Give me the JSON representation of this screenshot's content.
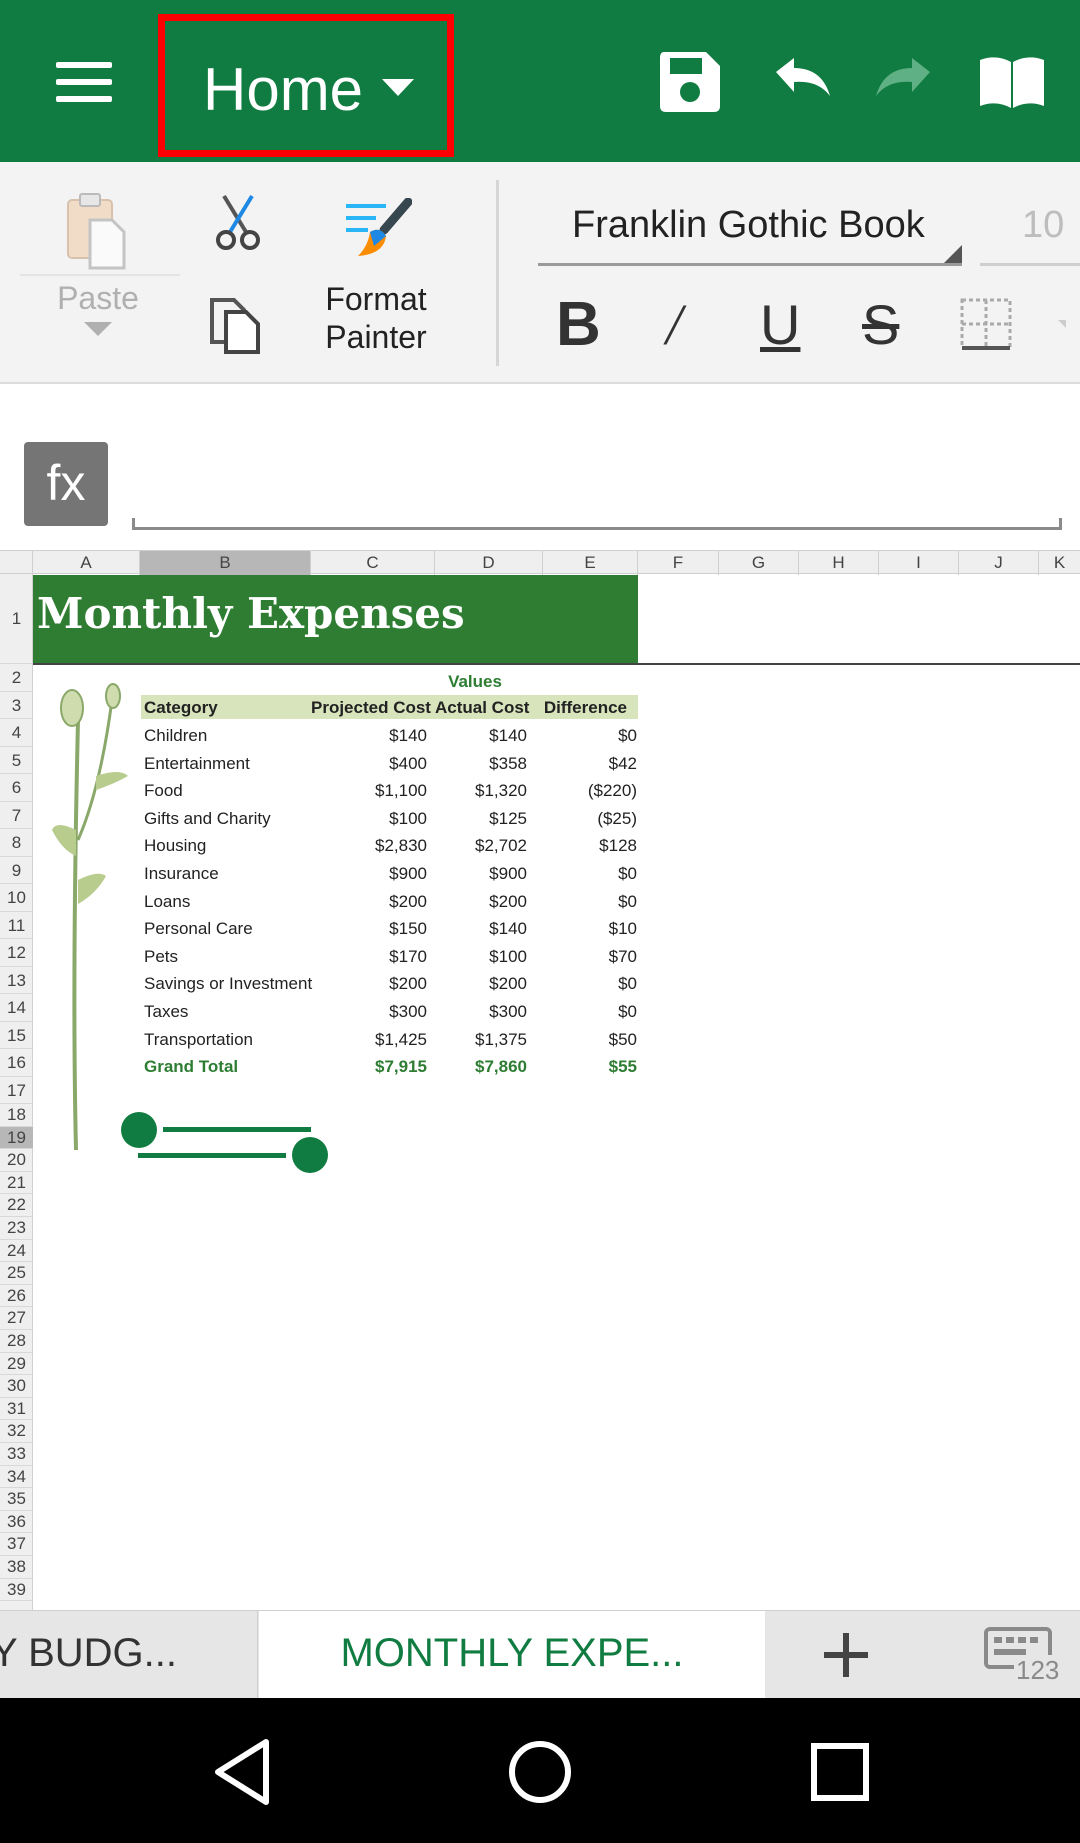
{
  "topbar": {
    "tab_label": "Home",
    "icons": [
      "menu-icon",
      "save-icon",
      "undo-icon",
      "redo-icon",
      "read-mode-icon"
    ],
    "accent_color": "#107c41",
    "highlight_color": "#ff0000"
  },
  "ribbon": {
    "paste_label": "Paste",
    "format_painter_label": "Format Painter",
    "font_name": "Franklin Gothic Book",
    "font_size": "10",
    "bold_label": "B",
    "italic_label": "/",
    "underline_label": "U",
    "strike_label": "S"
  },
  "formula_bar": {
    "fx_label": "fx",
    "value": ""
  },
  "grid": {
    "columns": [
      "A",
      "B",
      "C",
      "D",
      "E",
      "F",
      "G",
      "H",
      "I",
      "J",
      "K"
    ],
    "selected_column": "B",
    "rows": [
      "1",
      "2",
      "3",
      "4",
      "5",
      "6",
      "7",
      "8",
      "9",
      "10",
      "11",
      "12",
      "13",
      "14",
      "15",
      "16",
      "17",
      "18",
      "19",
      "20",
      "21",
      "22",
      "23",
      "24",
      "25",
      "26",
      "27",
      "28",
      "29",
      "30",
      "31",
      "32",
      "33",
      "34",
      "35",
      "36",
      "37",
      "38",
      "39"
    ],
    "selected_row": "19"
  },
  "sheet": {
    "title": "Monthly Expenses",
    "values_label": "Values",
    "headers": [
      "Category",
      "Projected Cost",
      "Actual Cost",
      "Difference"
    ],
    "rows": [
      [
        "Children",
        "$140",
        "$140",
        "$0"
      ],
      [
        "Entertainment",
        "$400",
        "$358",
        "$42"
      ],
      [
        "Food",
        "$1,100",
        "$1,320",
        "($220)"
      ],
      [
        "Gifts and Charity",
        "$100",
        "$125",
        "($25)"
      ],
      [
        "Housing",
        "$2,830",
        "$2,702",
        "$128"
      ],
      [
        "Insurance",
        "$900",
        "$900",
        "$0"
      ],
      [
        "Loans",
        "$200",
        "$200",
        "$0"
      ],
      [
        "Personal Care",
        "$150",
        "$140",
        "$10"
      ],
      [
        "Pets",
        "$170",
        "$100",
        "$70"
      ],
      [
        "Savings or Investment",
        "$200",
        "$200",
        "$0"
      ],
      [
        "Taxes",
        "$300",
        "$300",
        "$0"
      ],
      [
        "Transportation",
        "$1,425",
        "$1,375",
        "$50"
      ]
    ],
    "total": [
      "Grand Total",
      "$7,915",
      "$7,860",
      "$55"
    ],
    "title_band_color": "#2e7d32",
    "header_band_color": "#d8e4bc"
  },
  "tabs": {
    "sheet_1": "Y BUDG...",
    "sheet_2": "MONTHLY EXPE...",
    "add_icon": "plus-icon",
    "keyboard_label": "123"
  },
  "navbar": {
    "icons": [
      "back-icon",
      "home-icon",
      "recents-icon"
    ]
  }
}
